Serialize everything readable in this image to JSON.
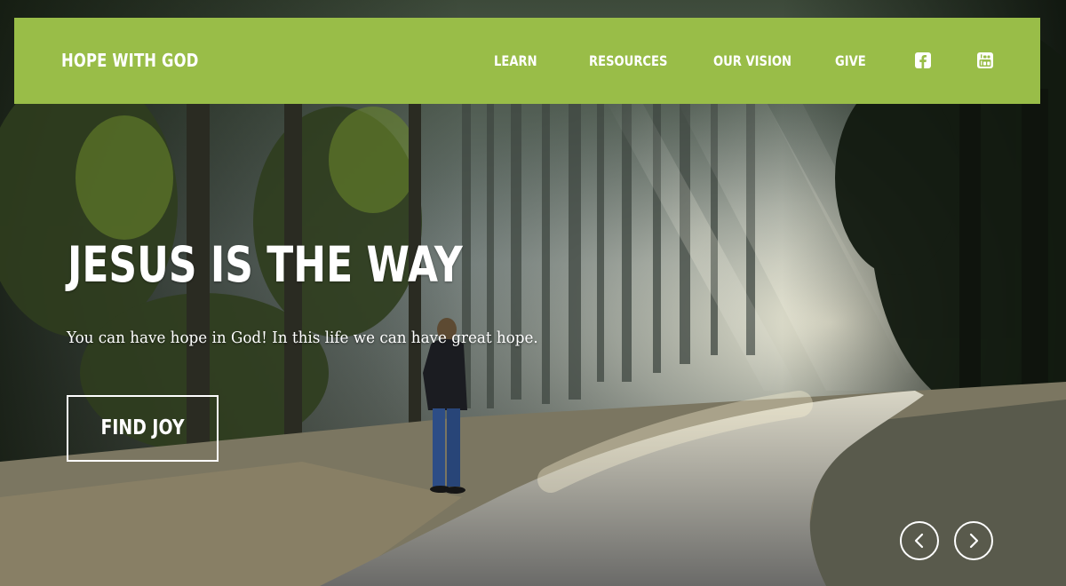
{
  "nav": {
    "brand": "HOPE WITH GOD",
    "links": [
      {
        "label": "LEARN"
      },
      {
        "label": "RESOURCES"
      },
      {
        "label": "OUR VISION"
      },
      {
        "label": "GIVE"
      }
    ],
    "social_icons": [
      "facebook-icon",
      "youtube-icon"
    ]
  },
  "hero": {
    "headline": "JESUS IS THE WAY",
    "subline": "You can have hope in God! In this life we can have great hope.",
    "cta_label": "FIND JOY"
  },
  "slider": {
    "prev_icon": "chevron-left-icon",
    "next_icon": "chevron-right-icon"
  },
  "colors": {
    "nav_background": "#99bd48",
    "text": "#ffffff"
  }
}
